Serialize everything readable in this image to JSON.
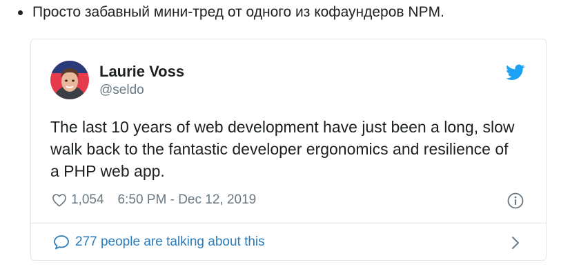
{
  "intro_text": "Просто забавный мини-тред от одного из кофаундеров NPM.",
  "tweet": {
    "author_name": "Laurie Voss",
    "author_handle": "@seldo",
    "text": "The last 10 years of web development have just been a long, slow walk back to the fantastic developer ergonomics and resilience of a PHP web app.",
    "likes": "1,054",
    "timestamp": "6:50 PM - Dec 12, 2019",
    "talking_about": "277 people are talking about this"
  },
  "icons": [
    "twitter-bird-icon",
    "heart-icon",
    "info-icon",
    "comment-bubble-icon",
    "chevron-right-icon"
  ],
  "colors": {
    "accent": "#1da1f2",
    "link": "#2b7bb9",
    "muted": "#697882",
    "border": "#e1e8ed"
  }
}
